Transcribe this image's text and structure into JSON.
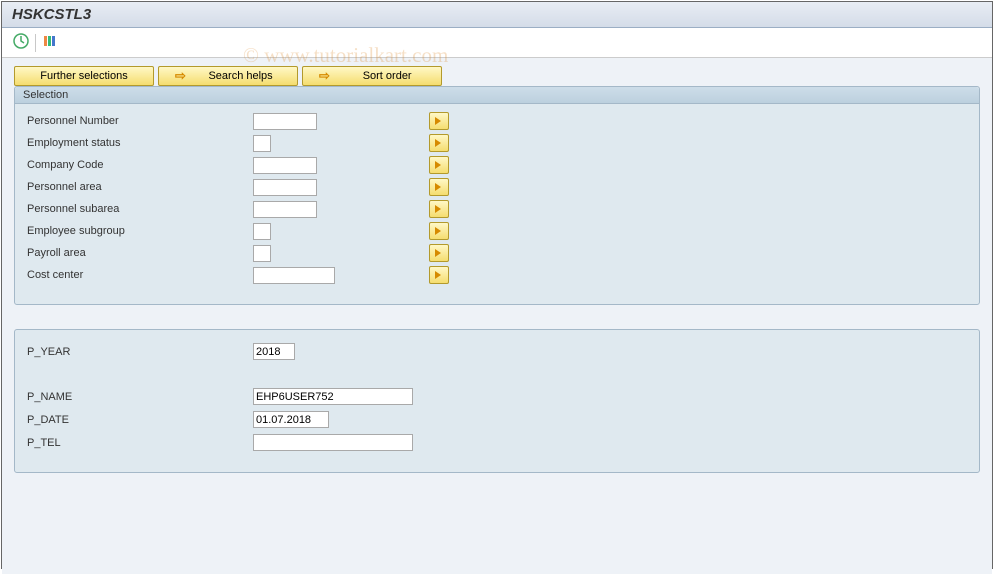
{
  "title": "HSKCSTL3",
  "watermark": "© www.tutorialkart.com",
  "toolbar_btns": {
    "further": "Further selections",
    "search": "Search helps",
    "sort": "Sort order"
  },
  "selection": {
    "header": "Selection",
    "rows": [
      {
        "label": "Personnel Number",
        "sz": "input-narrow"
      },
      {
        "label": "Employment status",
        "sz": "input-tiny"
      },
      {
        "label": "Company Code",
        "sz": "input-narrow"
      },
      {
        "label": "Personnel area",
        "sz": "input-narrow"
      },
      {
        "label": "Personnel subarea",
        "sz": "input-narrow"
      },
      {
        "label": "Employee subgroup",
        "sz": "input-tiny"
      },
      {
        "label": "Payroll area",
        "sz": "input-tiny"
      },
      {
        "label": "Cost center",
        "sz": "input-med"
      }
    ]
  },
  "params": {
    "year": {
      "label": "P_YEAR",
      "value": "2018"
    },
    "name": {
      "label": "P_NAME",
      "value": "EHP6USER752"
    },
    "date": {
      "label": "P_DATE",
      "value": "01.07.2018"
    },
    "tel": {
      "label": "P_TEL",
      "value": ""
    }
  }
}
